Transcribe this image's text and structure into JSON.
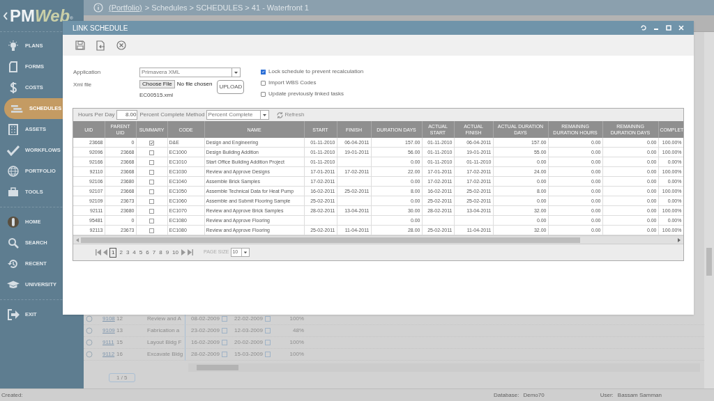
{
  "header": {
    "logo": {
      "prefix": "PM",
      "suffix": "Web",
      "mark": "®"
    },
    "breadcrumb_link": "(Portfolio)",
    "breadcrumb": "> Schedules > SCHEDULES > 41 - Waterfront 1"
  },
  "sidebar": {
    "items": [
      {
        "label": "PLANS",
        "selected": false
      },
      {
        "label": "FORMS",
        "selected": false
      },
      {
        "label": "COSTS",
        "selected": false
      },
      {
        "label": "SCHEDULES",
        "selected": true
      },
      {
        "label": "ASSETS",
        "selected": false
      },
      {
        "label": "WORKFLOWS",
        "selected": false
      },
      {
        "label": "PORTFOLIO",
        "selected": false
      },
      {
        "label": "TOOLS",
        "selected": false
      },
      {
        "label": "HOME",
        "selected": false
      },
      {
        "label": "SEARCH",
        "selected": false
      },
      {
        "label": "RECENT",
        "selected": false
      },
      {
        "label": "UNIVERSITY",
        "selected": false
      },
      {
        "label": "EXIT",
        "selected": false
      }
    ]
  },
  "background_rows": [
    {
      "id": "9108",
      "num": "12",
      "name": "Review and A",
      "start": "08-02-2009",
      "finish": "22-02-2009",
      "percent": "100%"
    },
    {
      "id": "9109",
      "num": "13",
      "name": "Fabrication a",
      "start": "23-02-2009",
      "finish": "12-03-2009",
      "percent": "48%"
    },
    {
      "id": "9111",
      "num": "15",
      "name": "Layout Bldg F",
      "start": "16-02-2009",
      "finish": "20-02-2009",
      "percent": "100%"
    },
    {
      "id": "9112",
      "num": "16",
      "name": "Excavate Bldg",
      "start": "28-02-2009",
      "finish": "15-03-2009",
      "percent": "100%"
    }
  ],
  "background_pager": "1 / 5",
  "status_bar": {
    "created_label": "Created:",
    "database_label": "Database:",
    "database": "Demo70",
    "user_label": "User:",
    "user": "Bassam Samman"
  },
  "dialog": {
    "title": "LINK SCHEDULE",
    "application_label": "Application",
    "application": "Primavera XML",
    "xml_label": "Xml file",
    "choose_file": "Choose File",
    "no_file": "No file chosen",
    "upload": "UPLOAD",
    "file_name": "EC00515.xml",
    "options": [
      {
        "label": "Lock schedule to prevent recalculation",
        "checked": true
      },
      {
        "label": "Import WBS Codes",
        "checked": false
      },
      {
        "label": "Update previously linked tasks",
        "checked": false
      }
    ],
    "hours_label": "Hours Per Day",
    "hours": "8.00",
    "method_label": "Percent Complete Method",
    "method": "Percent Complete",
    "refresh": "Refresh",
    "table": {
      "columns": [
        "UID",
        "PARENT UID",
        "SUMMARY",
        "CODE",
        "NAME",
        "START",
        "FINISH",
        "DURATION DAYS",
        "ACTUAL START",
        "ACTUAL FINISH",
        "ACTUAL DURATION DAYS",
        "REMAINING DURATION HOURS",
        "REMAINING DURATION DAYS",
        "COMPLET"
      ],
      "rows": [
        {
          "uid": "23668",
          "parent": "0",
          "summary": true,
          "code": "D&E",
          "name": "Design and Engineering",
          "start": "01-11-2010",
          "finish": "06-04-2011",
          "duration": "157.00",
          "actual_start": "01-11-2010",
          "actual_finish": "06-04-2011",
          "actual_duration": "157.00",
          "rem_hours": "0.00",
          "rem_days": "0.00",
          "complete": "100.00%"
        },
        {
          "uid": "92096",
          "parent": "23668",
          "summary": false,
          "code": "EC1000",
          "name": "Design Building Addition",
          "start": "01-11-2010",
          "finish": "19-01-2011",
          "duration": "56.00",
          "actual_start": "01-11-2010",
          "actual_finish": "19-01-2011",
          "actual_duration": "55.00",
          "rem_hours": "0.00",
          "rem_days": "0.00",
          "complete": "100.00%"
        },
        {
          "uid": "92166",
          "parent": "23668",
          "summary": false,
          "code": "EC1010",
          "name": "Start Office Building Addition Project",
          "start": "01-11-2010",
          "finish": "",
          "duration": "0.00",
          "actual_start": "01-11-2010",
          "actual_finish": "01-11-2010",
          "actual_duration": "0.00",
          "rem_hours": "0.00",
          "rem_days": "0.00",
          "complete": "0.00%"
        },
        {
          "uid": "92110",
          "parent": "23668",
          "summary": false,
          "code": "EC1030",
          "name": "Review and Approve Designs",
          "start": "17-01-2011",
          "finish": "17-02-2011",
          "duration": "22.00",
          "actual_start": "17-01-2011",
          "actual_finish": "17-02-2011",
          "actual_duration": "24.00",
          "rem_hours": "0.00",
          "rem_days": "0.00",
          "complete": "100.00%"
        },
        {
          "uid": "92106",
          "parent": "23680",
          "summary": false,
          "code": "EC1040",
          "name": "Assemble Brick Samples",
          "start": "17-02-2011",
          "finish": "",
          "duration": "0.00",
          "actual_start": "17-02-2011",
          "actual_finish": "17-02-2011",
          "actual_duration": "0.00",
          "rem_hours": "0.00",
          "rem_days": "0.00",
          "complete": "0.00%"
        },
        {
          "uid": "92107",
          "parent": "23668",
          "summary": false,
          "code": "EC1050",
          "name": "Assemble Technical Data for Heat Pump",
          "start": "16-02-2011",
          "finish": "25-02-2011",
          "duration": "8.00",
          "actual_start": "16-02-2011",
          "actual_finish": "25-02-2011",
          "actual_duration": "8.00",
          "rem_hours": "0.00",
          "rem_days": "0.00",
          "complete": "100.00%"
        },
        {
          "uid": "92109",
          "parent": "23673",
          "summary": false,
          "code": "EC1060",
          "name": "Assemble and Submit Flooring Sample",
          "start": "25-02-2011",
          "finish": "",
          "duration": "0.00",
          "actual_start": "25-02-2011",
          "actual_finish": "25-02-2011",
          "actual_duration": "0.00",
          "rem_hours": "0.00",
          "rem_days": "0.00",
          "complete": "0.00%"
        },
        {
          "uid": "92111",
          "parent": "23680",
          "summary": false,
          "code": "EC1070",
          "name": "Review and Approve Brick Samples",
          "start": "28-02-2011",
          "finish": "13-04-2011",
          "duration": "30.00",
          "actual_start": "28-02-2011",
          "actual_finish": "13-04-2011",
          "actual_duration": "32.00",
          "rem_hours": "0.00",
          "rem_days": "0.00",
          "complete": "100.00%"
        },
        {
          "uid": "95481",
          "parent": "0",
          "summary": false,
          "code": "EC1080",
          "name": "Review and Approve Flooring",
          "start": "",
          "finish": "",
          "duration": "0.00",
          "actual_start": "",
          "actual_finish": "",
          "actual_duration": "0.00",
          "rem_hours": "0.00",
          "rem_days": "0.00",
          "complete": "0.00%"
        },
        {
          "uid": "92113",
          "parent": "23673",
          "summary": false,
          "code": "EC1080",
          "name": "Review and Approve Flooring",
          "start": "25-02-2011",
          "finish": "11-04-2011",
          "duration": "28.00",
          "actual_start": "25-02-2011",
          "actual_finish": "11-04-2011",
          "actual_duration": "32.00",
          "rem_hours": "0.00",
          "rem_days": "0.00",
          "complete": "100.00%"
        }
      ]
    },
    "pages": [
      {
        "label": "1",
        "selected": true
      },
      {
        "label": "2",
        "selected": false
      },
      {
        "label": "3",
        "selected": false
      },
      {
        "label": "4",
        "selected": false
      },
      {
        "label": "5",
        "selected": false
      },
      {
        "label": "6",
        "selected": false
      },
      {
        "label": "7",
        "selected": false
      },
      {
        "label": "8",
        "selected": false
      },
      {
        "label": "9",
        "selected": false
      },
      {
        "label": "10",
        "selected": false
      }
    ],
    "page_size_label": "PAGE SIZE",
    "page_size": "10"
  }
}
